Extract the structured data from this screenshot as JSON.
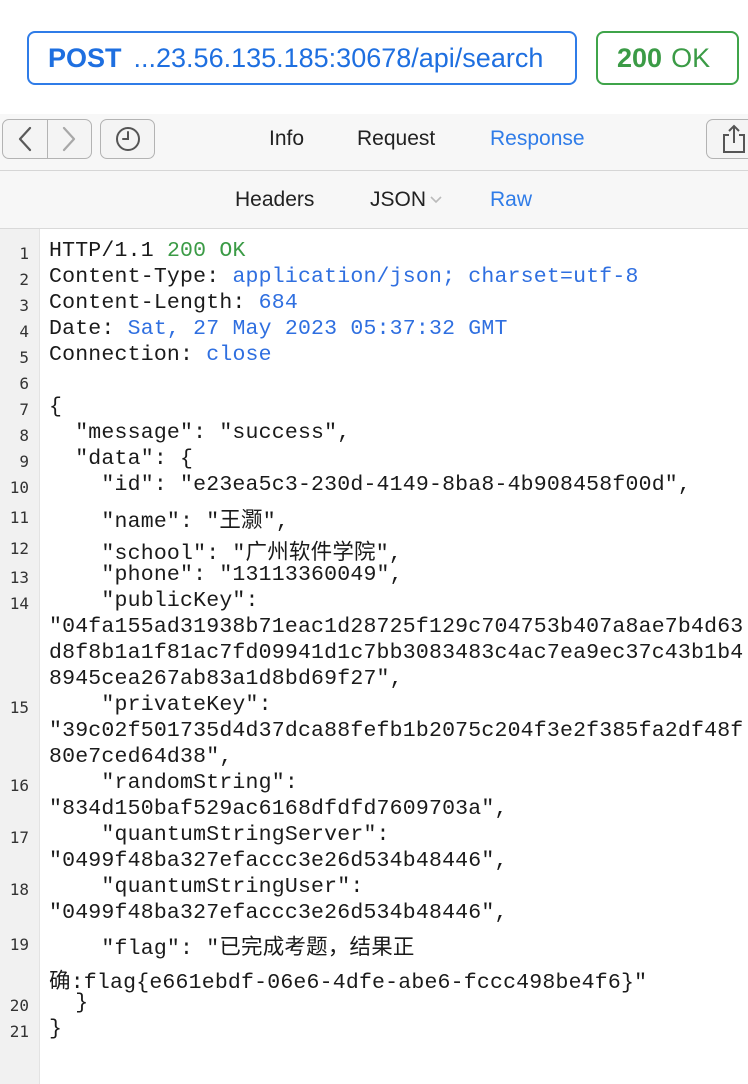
{
  "request": {
    "method": "POST",
    "url": "...23.56.135.185:30678/api/search",
    "status_code": "200",
    "status_text": "OK"
  },
  "toolbar": {
    "icons": [
      "chevron-left-icon",
      "chevron-right-icon",
      "clock-icon",
      "share-icon"
    ],
    "tabs": [
      "Info",
      "Request",
      "Response"
    ],
    "active_tab": "Response"
  },
  "subtoolbar": {
    "tabs": [
      "Headers",
      "JSON",
      "Raw"
    ],
    "active_tab": "Raw"
  },
  "colors": {
    "accent_blue": "#2f7ce8",
    "status_green": "#3b9b46"
  },
  "response": {
    "headers": {
      "protocol": "HTTP/1.1",
      "status_code": "200",
      "status_text": "OK",
      "content_type_key": "Content-Type:",
      "content_type": "application/json; charset=utf-8",
      "content_length_key": "Content-Length:",
      "content_length": "684",
      "date_key": "Date:",
      "date": "Sat, 27 May 2023 05:37:32 GMT",
      "connection_key": "Connection:",
      "connection": "close"
    },
    "line_numbers": [
      "1",
      "2",
      "3",
      "4",
      "5",
      "6",
      "7",
      "8",
      "9",
      "10",
      "11",
      "12",
      "13",
      "14",
      "15",
      "16",
      "17",
      "18",
      "19",
      "20",
      "21"
    ],
    "body_lines": [
      "{",
      "  \"message\": \"success\",",
      "  \"data\": {",
      "    \"id\": \"e23ea5c3-230d-4149-8ba8-4b908458f00d\",",
      "    \"name\": \"王灏\",",
      "    \"school\": \"广州软件学院\",",
      "    \"phone\": \"13113360049\",",
      "    \"publicKey\":",
      "\"04fa155ad31938b71eac1d28725f129c704753b407a8ae7b4d63",
      "d8f8b1a1f81ac7fd09941d1c7bb3083483c4ac7ea9ec37c43b1b4",
      "8945cea267ab83a1d8bd69f27\",",
      "    \"privateKey\":",
      "\"39c02f501735d4d37dca88fefb1b2075c204f3e2f385fa2df48f",
      "80e7ced64d38\",",
      "    \"randomString\":",
      "\"834d150baf529ac6168dfdfd7609703a\",",
      "    \"quantumStringServer\":",
      "\"0499f48ba327efaccc3e26d534b48446\",",
      "    \"quantumStringUser\":",
      "\"0499f48ba327efaccc3e26d534b48446\",",
      "    \"flag\": \"已完成考题，结果正",
      "确:flag{e661ebdf-06e6-4dfe-abe6-fccc498be4f6}\"",
      "  }",
      "}"
    ]
  }
}
